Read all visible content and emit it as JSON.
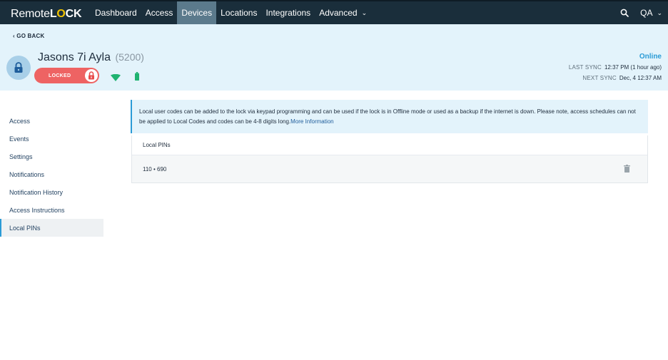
{
  "nav": {
    "logo_prefix": "Remote",
    "logo_l": "L",
    "logo_o": "O",
    "logo_suffix": "CK",
    "items": [
      {
        "label": "Dashboard"
      },
      {
        "label": "Access"
      },
      {
        "label": "Devices"
      },
      {
        "label": "Locations"
      },
      {
        "label": "Integrations"
      },
      {
        "label": "Advanced"
      }
    ],
    "active_item": "Devices",
    "user": "QA",
    "icons": {
      "search": "search-icon",
      "chevron": "chevron-down-icon"
    }
  },
  "header": {
    "go_back": "‹ GO BACK",
    "device_name": "Jasons 7i Ayla",
    "device_model": "(5200)",
    "lock_status": "LOCKED",
    "connection_status": "Online",
    "last_sync_label": "LAST SYNC",
    "last_sync_value": "12:37 PM (1 hour ago)",
    "next_sync_label": "NEXT SYNC",
    "next_sync_value": "Dec, 4 12:37 AM",
    "colors": {
      "header_bg": "#e3f3fb",
      "locked_pill": "#ee6363",
      "online": "#2b9bd6",
      "wifi": "#1fb371",
      "battery": "#1fb371"
    },
    "icons": {
      "avatar": "lock-icon",
      "pill": "padlock-icon",
      "wifi": "wifi-icon",
      "battery": "battery-icon"
    }
  },
  "sidebar": {
    "items": [
      {
        "label": "Access"
      },
      {
        "label": "Events"
      },
      {
        "label": "Settings"
      },
      {
        "label": "Notifications"
      },
      {
        "label": "Notification History"
      },
      {
        "label": "Access Instructions"
      },
      {
        "label": "Local PINs"
      }
    ],
    "active_item": "Local PINs"
  },
  "main": {
    "info_text": "Local user codes can be added to the lock via keypad programming and can be used if the lock is in Offline mode or used as a backup if the internet is down. Please note, access schedules can not be applied to Local Codes and codes can be 4-8 digits long.",
    "info_link": "More Information",
    "pins_header": "Local PINs",
    "pins": [
      {
        "value": "110 • 690"
      }
    ],
    "icons": {
      "delete": "trash-icon"
    }
  }
}
